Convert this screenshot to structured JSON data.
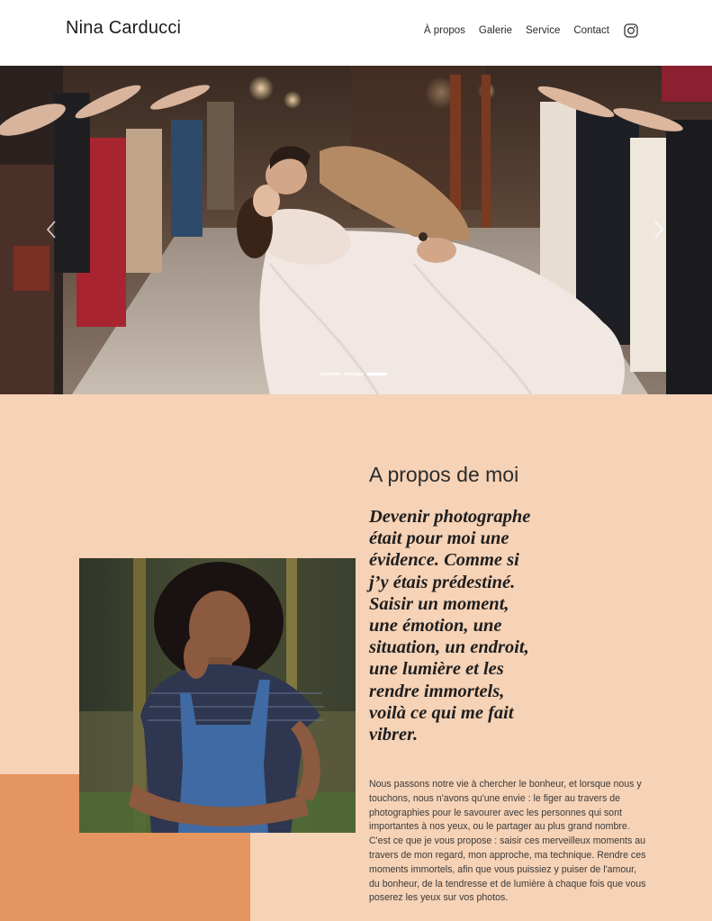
{
  "header": {
    "brand": "Nina Carducci",
    "nav": {
      "about": "À propos",
      "gallery": "Galerie",
      "service": "Service",
      "contact": "Contact"
    },
    "social_icon": "instagram-icon"
  },
  "hero": {
    "image": "wedding-couple-kiss-photo",
    "prev_icon": "chevron-left-icon",
    "next_icon": "chevron-right-icon",
    "slide_count": 3,
    "active_slide": 3
  },
  "about": {
    "title": "A propos de moi",
    "quote": "Devenir photographe était pour moi une évidence. Comme si j’y étais prédestiné. Saisir un moment, une émotion, une situation, un endroit, une lumière et les rendre immortels, voilà ce qui me fait vibrer.",
    "body": "Nous passons notre vie à chercher le bonheur, et lorsque nous y touchons, nous n'avons qu'une envie : le figer au travers de photographies pour le savourer avec les personnes qui sont importantes à nos yeux, ou le partager au plus grand nombre. C'est ce que je vous propose : saisir ces merveilleux moments au travers de mon regard, mon approche, ma technique. Rendre ces moments immortels, afin que vous puissiez y puiser de l'amour, du bonheur, de la tendresse et de lumière à chaque fois que vous poserez les yeux sur vos photos.",
    "portrait": "portrait-photo"
  },
  "colors": {
    "about_background": "#f6d2b6",
    "accent_block": "#e59660"
  }
}
